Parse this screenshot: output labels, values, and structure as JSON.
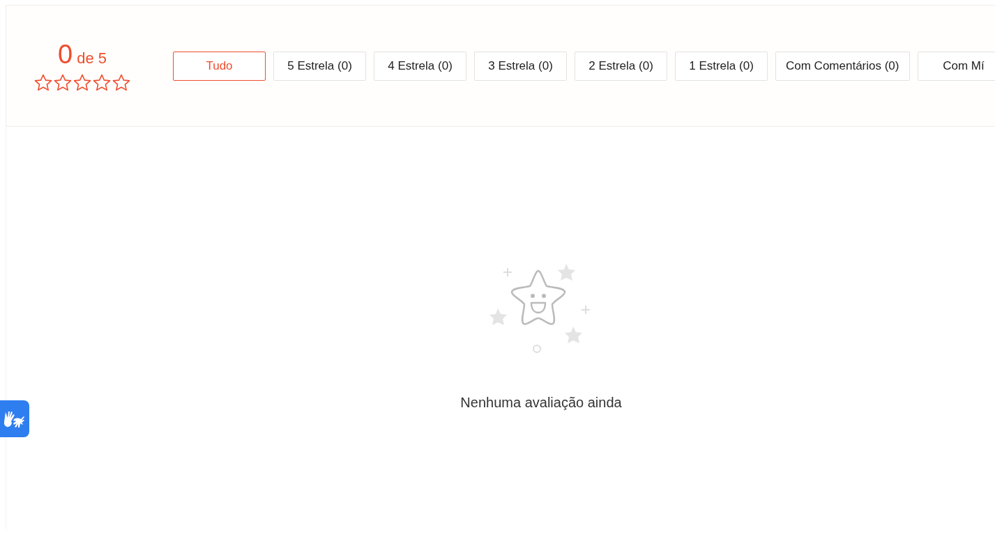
{
  "rating": {
    "score": "0",
    "out_of": "de 5",
    "stars": 0
  },
  "filters": [
    {
      "label": "Tudo",
      "selected": true
    },
    {
      "label": "5 Estrela (0)",
      "selected": false
    },
    {
      "label": "4 Estrela (0)",
      "selected": false
    },
    {
      "label": "3 Estrela (0)",
      "selected": false
    },
    {
      "label": "2 Estrela (0)",
      "selected": false
    },
    {
      "label": "1 Estrela (0)",
      "selected": false
    },
    {
      "label": "Com Comentários (0)",
      "selected": false
    },
    {
      "label": "Com Mí",
      "selected": false
    }
  ],
  "empty_state": {
    "message": "Nenhuma avaliação ainda"
  }
}
